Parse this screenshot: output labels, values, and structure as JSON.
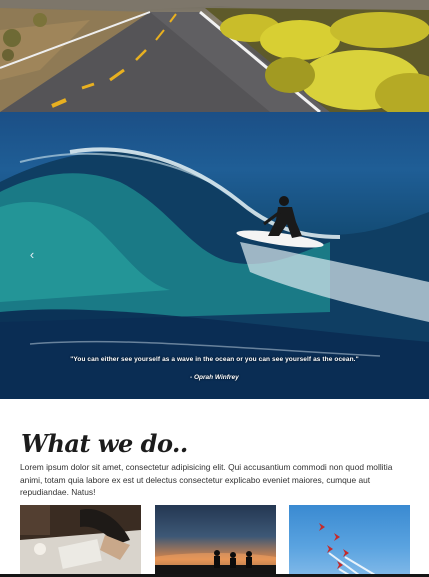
{
  "hero": {
    "prev_icon": "chevron-left-icon",
    "quote": "\"You can either see yourself as a wave in the ocean or you can see yourself as the ocean.\"",
    "author": "- Oprah Winfrey"
  },
  "section": {
    "heading": "What we do..",
    "body": "Lorem ipsum dolor sit amet, consectetur adipisicing elit. Qui accusantium commodi non quod mollitia animi, totam quia labore ex est ut delectus consectetur explicabo eveniet maiores, cumque aut repudiandae. Natus!"
  },
  "colors": {
    "ocean": "#1b4f86",
    "heading": "#1c1c1c",
    "body_text": "#333333"
  }
}
